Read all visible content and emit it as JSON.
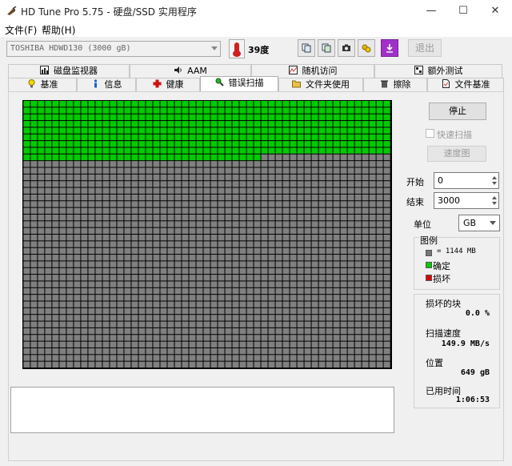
{
  "titlebar": {
    "title": "HD Tune Pro 5.75 - 硬盘/SSD 实用程序",
    "minimize": "—",
    "maximize": "☐",
    "close": "✕"
  },
  "menu": {
    "file": "文件(F)",
    "help": "帮助(H)"
  },
  "toolbar": {
    "drive": "TOSHIBA HDWD130 (3000 gB)",
    "temperature": "39度",
    "exit_label": "退出",
    "icons": [
      "copy-info-icon",
      "copy-all-icon",
      "screenshot-icon",
      "options-icon",
      "save-icon"
    ]
  },
  "tabs": {
    "top": [
      "磁盘监视器",
      "AAM",
      "随机访问",
      "额外测试"
    ],
    "bottom": [
      "基准",
      "信息",
      "健康",
      "错误扫描",
      "文件夹使用",
      "擦除",
      "文件基准"
    ],
    "active": "错误扫描"
  },
  "scan": {
    "stop_label": "停止",
    "quick_scan_label": "快速扫描",
    "quick_scan_checked": false,
    "speed_map_label": "速度图",
    "start_label": "开始",
    "start_value": "0",
    "end_label": "结束",
    "end_value": "3000",
    "unit_label": "单位",
    "unit_value": "GB"
  },
  "legend": {
    "title": "图例",
    "block_size": "= 1144 MB",
    "ok_label": "确定",
    "bad_label": "损坏"
  },
  "stats": {
    "damaged_label": "损坏的块",
    "damaged_value": "0.0 %",
    "speed_label": "扫描速度",
    "speed_value": "149.9 MB/s",
    "position_label": "位置",
    "position_value": "649 gB",
    "elapsed_label": "已用时间",
    "elapsed_value": "1:06:53"
  },
  "grid_map": {
    "columns": 51,
    "rows": 40,
    "scanned_fraction": 0.216,
    "colors": {
      "ok": "#00cc00",
      "pending": "#808080",
      "bad": "#dd0000",
      "line": "#000000"
    }
  }
}
